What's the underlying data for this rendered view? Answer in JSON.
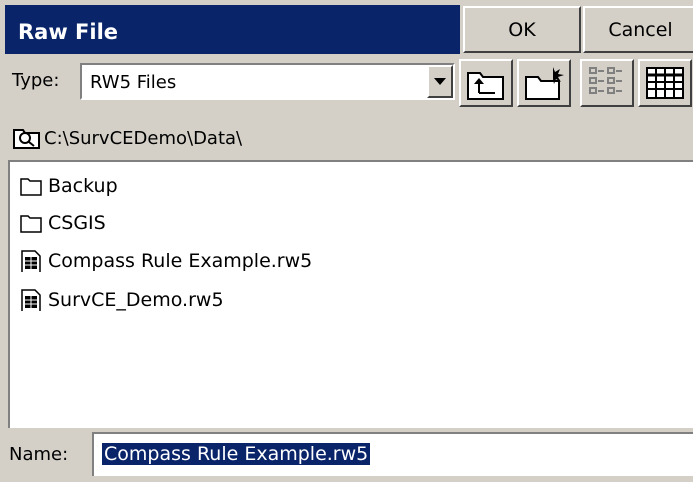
{
  "title": "Raw File",
  "buttons": {
    "ok": "OK",
    "cancel": "Cancel"
  },
  "type": {
    "label": "Type:",
    "value": "RW5 Files"
  },
  "path": "C:\\SurvCEDemo\\Data\\",
  "files": [
    {
      "name": "Backup",
      "kind": "folder"
    },
    {
      "name": "CSGIS",
      "kind": "folder"
    },
    {
      "name": "Compass Rule Example.rw5",
      "kind": "file"
    },
    {
      "name": "SurvCE_Demo.rw5",
      "kind": "file"
    }
  ],
  "name": {
    "label": "Name:",
    "value": "Compass Rule Example.rw5"
  },
  "toolbar_icons": [
    "up-folder-icon",
    "new-folder-icon",
    "list-view-icon",
    "details-view-icon"
  ],
  "colors": {
    "titlebar": "#0a246a",
    "selection": "#0a246a",
    "face": "#d4d0c8"
  }
}
